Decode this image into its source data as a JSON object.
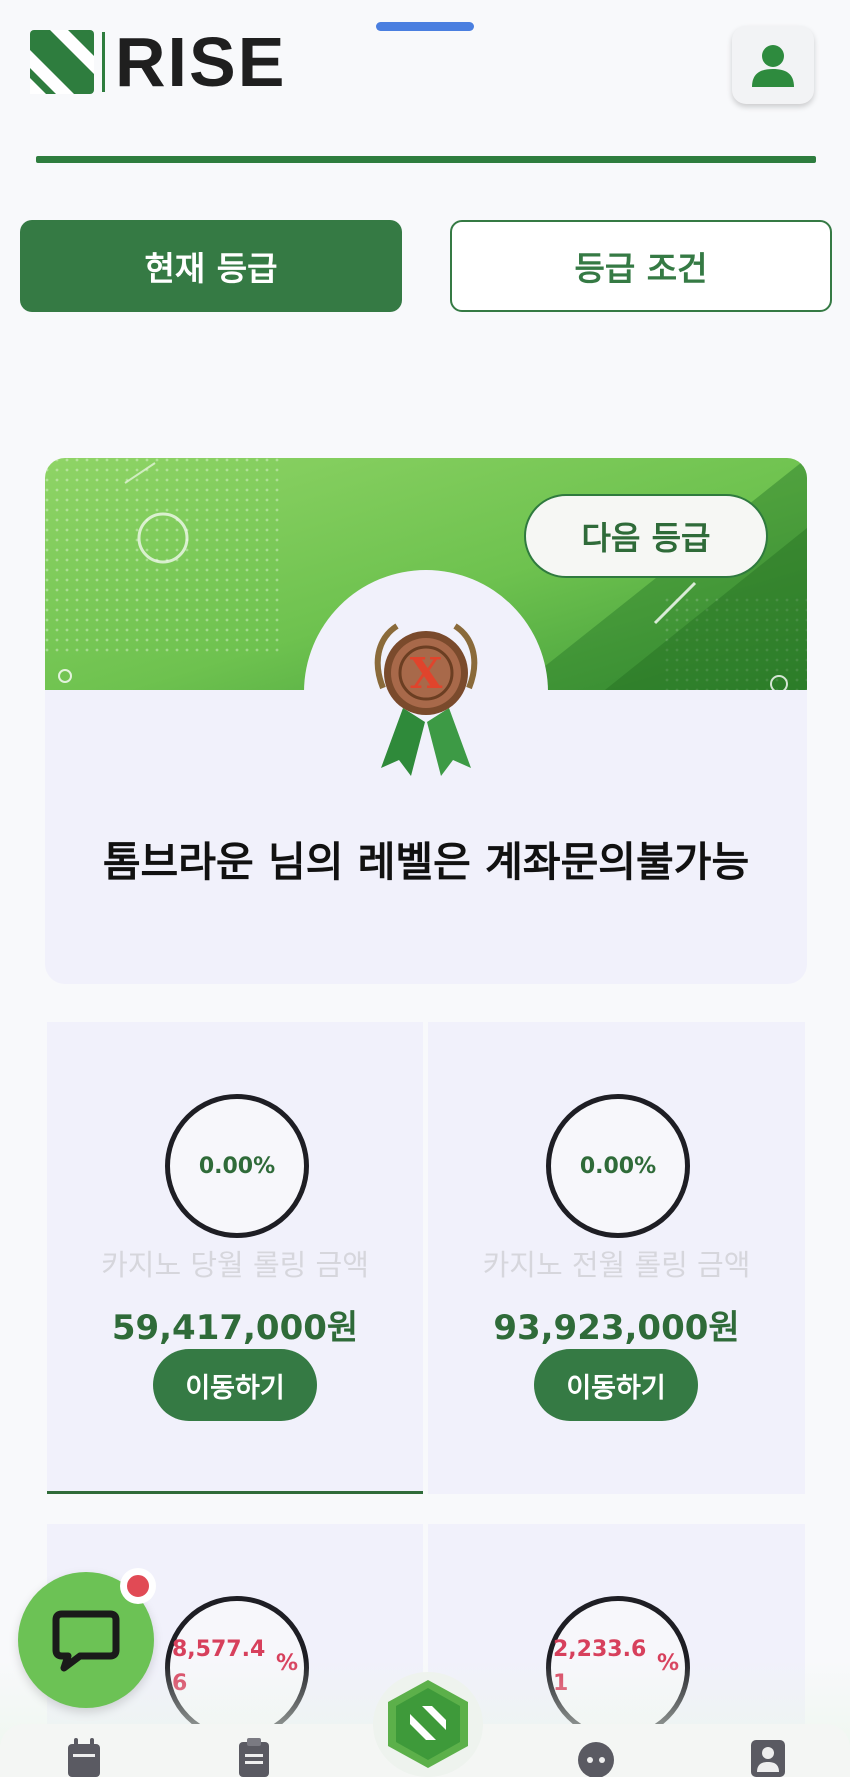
{
  "header": {
    "logo_text": "RISE"
  },
  "tabs": {
    "current": "현재 등급",
    "conditions": "등급 조건"
  },
  "level_card": {
    "next_button": "다음 등급",
    "level_text": "톰브라운 님의 레벨은 계좌문의불가능"
  },
  "stats": [
    {
      "percent": "0.00%",
      "label": "카지노 당월 롤링 금액",
      "amount": "59,417,000원",
      "button": "이동하기"
    },
    {
      "percent": "0.00%",
      "label": "카지노 전월 롤링 금액",
      "amount": "93,923,000원",
      "button": "이동하기"
    },
    {
      "value": "8,577.46",
      "unit": "%"
    },
    {
      "value": "2,233.61",
      "unit": "%"
    }
  ],
  "colors": {
    "primary": "#357a44",
    "accent_green": "#6cc255",
    "alert_red": "#d7405c",
    "card_bg": "#f1f1fb"
  },
  "icons": {
    "profile": "person-icon",
    "chat": "chat-bubble-icon",
    "nav": [
      "calendar-icon",
      "clipboard-icon",
      "home-logo-icon",
      "support-bot-icon",
      "user-card-icon"
    ]
  }
}
